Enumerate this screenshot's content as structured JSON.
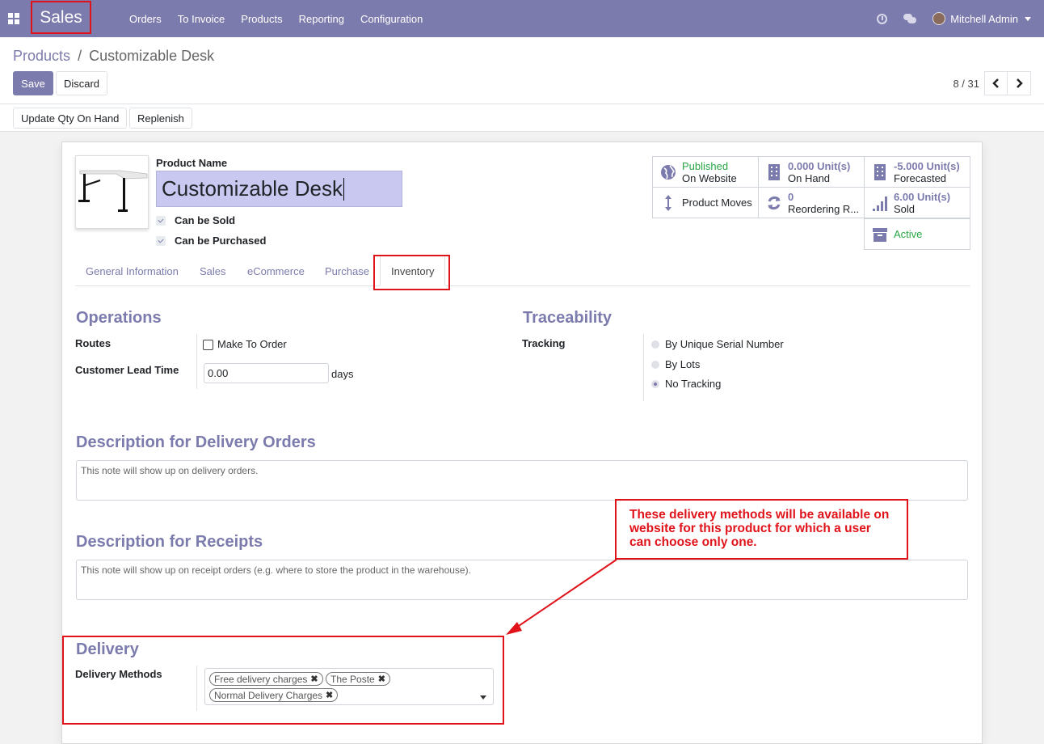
{
  "navbar": {
    "app_name": "Sales",
    "menu": [
      "Orders",
      "To Invoice",
      "Products",
      "Reporting",
      "Configuration"
    ],
    "user": "Mitchell Admin"
  },
  "control_panel": {
    "breadcrumb_parent": "Products",
    "breadcrumb_sep": "/",
    "breadcrumb_current": "Customizable Desk",
    "save_label": "Save",
    "discard_label": "Discard",
    "pager_value": "8 / 31",
    "pager_prev": "‹",
    "pager_next": "›"
  },
  "statusbar": {
    "update_qty_label": "Update Qty On Hand",
    "replenish_label": "Replenish"
  },
  "product": {
    "name_label": "Product Name",
    "name": "Customizable Desk",
    "can_be_sold": "Can be Sold",
    "can_be_purchased": "Can be Purchased"
  },
  "smart_buttons": {
    "published_line1": "Published",
    "published_line2": "On Website",
    "onhand_value": "0.000",
    "onhand_unit": "Unit(s)",
    "onhand_label": "On Hand",
    "forecast_value": "-5.000",
    "forecast_unit": "Unit(s)",
    "forecast_label": "Forecasted",
    "moves_label": "Product Moves",
    "reorder_value": "0",
    "reorder_label": "Reordering R...",
    "sold_value": "6.00",
    "sold_unit": "Unit(s)",
    "sold_label": "Sold",
    "active_label": "Active"
  },
  "tabs": [
    "General Information",
    "Sales",
    "eCommerce",
    "Purchase",
    "Inventory"
  ],
  "operations": {
    "title": "Operations",
    "routes_label": "Routes",
    "make_to_order": "Make To Order",
    "lead_time_label": "Customer Lead Time",
    "lead_time_value": "0.00",
    "lead_time_unit": "days"
  },
  "traceability": {
    "title": "Traceability",
    "tracking_label": "Tracking",
    "options": [
      "By Unique Serial Number",
      "By Lots",
      "No Tracking"
    ],
    "selected": "No Tracking"
  },
  "delivery_orders": {
    "title": "Description for Delivery Orders",
    "placeholder": "This note will show up on delivery orders."
  },
  "receipts": {
    "title": "Description for Receipts",
    "placeholder": "This note will show up on receipt orders (e.g. where to store the product in the warehouse)."
  },
  "delivery": {
    "title": "Delivery",
    "methods_label": "Delivery Methods",
    "tags": [
      "Free delivery charges",
      "The Poste",
      "Normal Delivery Charges"
    ],
    "tag_remove": "✖"
  },
  "callout": {
    "text": "These delivery methods will be available on website for this product for which a user can choose only one."
  },
  "colors": {
    "brand": "#7c7bad",
    "annotation": "#e0131a",
    "success": "#28a745"
  }
}
